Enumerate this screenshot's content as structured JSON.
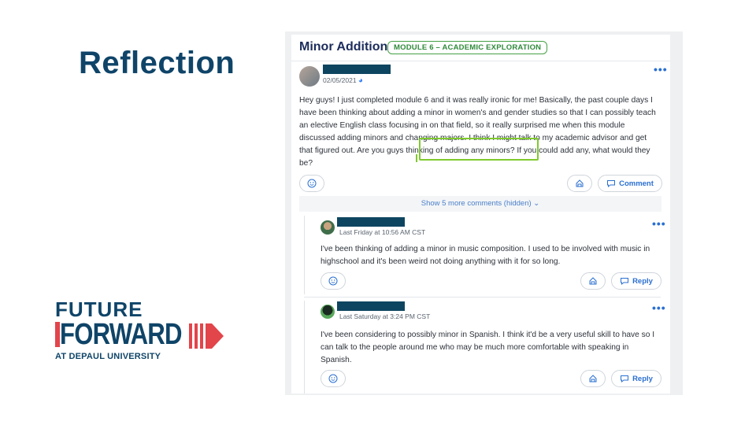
{
  "slide": {
    "title": "Reflection"
  },
  "logo": {
    "line1": "FUTURE",
    "line2": "FORWARD",
    "line3": "AT DEPAUL UNIVERSITY"
  },
  "post": {
    "title": "Minor Addition",
    "badge": "MODULE 6 – ACADEMIC EXPLORATION",
    "date": "02/05/2021",
    "body": "Hey guys! I just completed module 6 and it was really ironic for me! Basically, the past couple days I have been thinking about adding a minor in women's and gender studies so that I can possibly teach an elective English class focusing in on that field, so it really surprised me when this module discussed adding minors and changing majors. I think I might talk to my academic advisor and get that figured out. Are you guys thinking of adding any minors? If you could add any, what would they be?",
    "comment_label": "Comment",
    "show_more": "Show 5 more comments (hidden)"
  },
  "comments": [
    {
      "timestamp": "Last Friday at 10:56 AM CST",
      "body": "I've been thinking of adding a minor in music composition. I used to be involved with music in highschool and it's been weird not doing anything with it for so long.",
      "reply_label": "Reply"
    },
    {
      "timestamp": "Last Saturday at 3:24 PM CST",
      "body": "I've been considering to possibly minor in Spanish. I think it'd be a very useful skill to have so I can talk to the people around me who may be much more comfortable with speaking in Spanish.",
      "reply_label": "Reply"
    }
  ],
  "icons": {
    "more": "more-options-icon",
    "emoji": "smiley-icon",
    "bookmark": "bookmark-icon",
    "comment": "comment-bubble-icon"
  },
  "colors": {
    "title": "#0f4468",
    "accent": "#2a6fd1",
    "badge": "#2f8a3a",
    "highlight": "#7fca2e",
    "redaction": "#0d4560"
  }
}
